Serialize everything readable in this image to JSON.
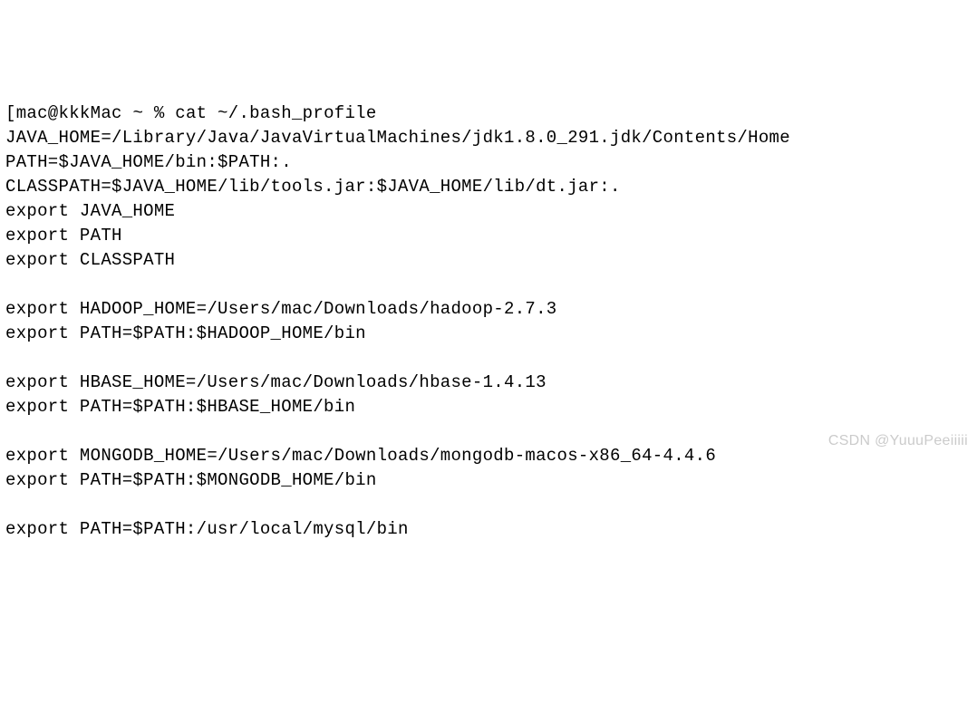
{
  "prompt": {
    "lead": "[",
    "user_host": "mac@kkkMac",
    "cwd": "~",
    "symbol": "%",
    "command": "cat ~/.bash_profile"
  },
  "lines": [
    "JAVA_HOME=/Library/Java/JavaVirtualMachines/jdk1.8.0_291.jdk/Contents/Home",
    "PATH=$JAVA_HOME/bin:$PATH:.",
    "CLASSPATH=$JAVA_HOME/lib/tools.jar:$JAVA_HOME/lib/dt.jar:.",
    "export JAVA_HOME",
    "export PATH",
    "export CLASSPATH",
    "",
    "export HADOOP_HOME=/Users/mac/Downloads/hadoop-2.7.3",
    "export PATH=$PATH:$HADOOP_HOME/bin",
    "",
    "export HBASE_HOME=/Users/mac/Downloads/hbase-1.4.13",
    "export PATH=$PATH:$HBASE_HOME/bin",
    "",
    "export MONGODB_HOME=/Users/mac/Downloads/mongodb-macos-x86_64-4.4.6",
    "export PATH=$PATH:$MONGODB_HOME/bin",
    "",
    "export PATH=$PATH:/usr/local/mysql/bin"
  ],
  "watermark": "CSDN @YuuuPeeiiiii"
}
